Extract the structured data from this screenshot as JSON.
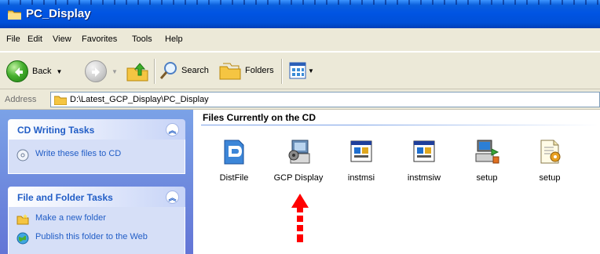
{
  "window": {
    "title": "PC_Display"
  },
  "menu": {
    "items": [
      "File",
      "Edit",
      "View",
      "Favorites",
      "Tools",
      "Help"
    ]
  },
  "toolbar": {
    "back_label": "Back",
    "search_label": "Search",
    "folders_label": "Folders"
  },
  "address": {
    "label": "Address",
    "value": "D:\\Latest_GCP_Display\\PC_Display"
  },
  "taskpane": {
    "cd_tasks": {
      "title": "CD Writing Tasks",
      "links": [
        "Write these files to CD"
      ]
    },
    "folder_tasks": {
      "title": "File and Folder Tasks",
      "links": [
        "Make a new folder",
        "Publish this folder to the Web"
      ]
    }
  },
  "files": {
    "header": "Files Currently on the CD",
    "items": [
      {
        "name": "DistFile",
        "icon": "distfile-icon"
      },
      {
        "name": "GCP Display",
        "icon": "gcp-display-icon"
      },
      {
        "name": "instmsi",
        "icon": "instmsi-icon"
      },
      {
        "name": "instmsiw",
        "icon": "instmsiw-icon"
      },
      {
        "name": "setup",
        "icon": "setup-computer-icon"
      },
      {
        "name": "setup",
        "icon": "setup-file-icon"
      }
    ]
  },
  "annotation": {
    "arrow_color": "#ff0000"
  }
}
